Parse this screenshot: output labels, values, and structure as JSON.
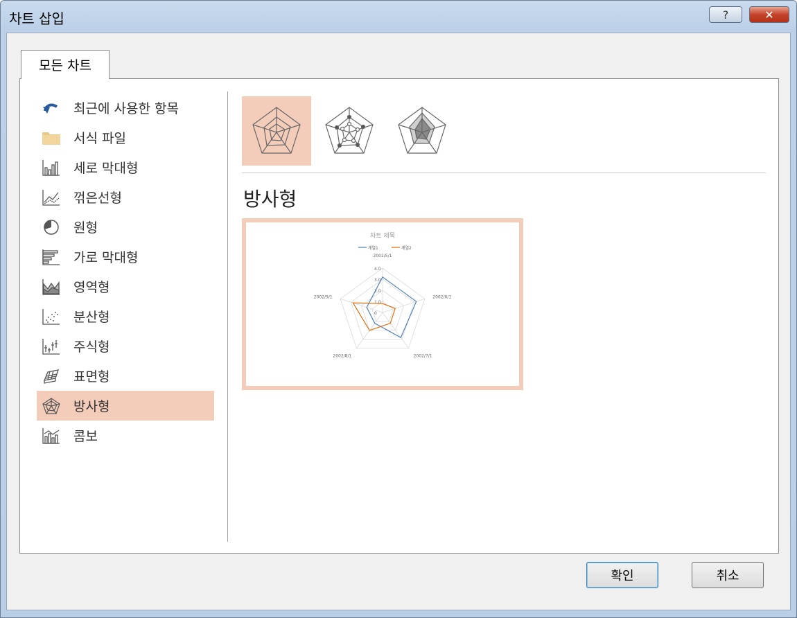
{
  "window": {
    "title": "차트 삽입",
    "help_label": "?",
    "close_label": "✕"
  },
  "tab": {
    "label": "모든 차트"
  },
  "sidebar": {
    "items": [
      {
        "label": "최근에 사용한 항목",
        "icon": "recent-icon",
        "selected": false
      },
      {
        "label": "서식 파일",
        "icon": "folder-icon",
        "selected": false
      },
      {
        "label": "세로 막대형",
        "icon": "column-chart-icon",
        "selected": false
      },
      {
        "label": "꺾은선형",
        "icon": "line-chart-icon",
        "selected": false
      },
      {
        "label": "원형",
        "icon": "pie-chart-icon",
        "selected": false
      },
      {
        "label": "가로 막대형",
        "icon": "bar-chart-icon",
        "selected": false
      },
      {
        "label": "영역형",
        "icon": "area-chart-icon",
        "selected": false
      },
      {
        "label": "분산형",
        "icon": "scatter-chart-icon",
        "selected": false
      },
      {
        "label": "주식형",
        "icon": "stock-chart-icon",
        "selected": false
      },
      {
        "label": "표면형",
        "icon": "surface-chart-icon",
        "selected": false
      },
      {
        "label": "방사형",
        "icon": "radar-chart-icon",
        "selected": true
      },
      {
        "label": "콤보",
        "icon": "combo-chart-icon",
        "selected": false
      }
    ]
  },
  "subtypes": [
    {
      "icon": "radar-icon",
      "selected": true
    },
    {
      "icon": "radar-markers-icon",
      "selected": false
    },
    {
      "icon": "filled-radar-icon",
      "selected": false
    }
  ],
  "main": {
    "heading": "방사형"
  },
  "preview": {
    "chart_data": {
      "type": "radar",
      "title": "차트 제목",
      "categories": [
        "2002/5/1",
        "2002/6/1",
        "2002/7/1",
        "2002/8/1",
        "2002/9/1"
      ],
      "series": [
        {
          "name": "계열1",
          "values": [
            32,
            32,
            28,
            12,
            15
          ],
          "color": "#4f81bd"
        },
        {
          "name": "계열2",
          "values": [
            8,
            12,
            12,
            20,
            28
          ],
          "color": "#e46c0a"
        }
      ],
      "rlim": [
        0,
        40
      ],
      "ticks": [
        "0",
        "1.0",
        "2.0",
        "3.0",
        "4.0"
      ]
    }
  },
  "buttons": {
    "ok": "확인",
    "cancel": "취소"
  }
}
